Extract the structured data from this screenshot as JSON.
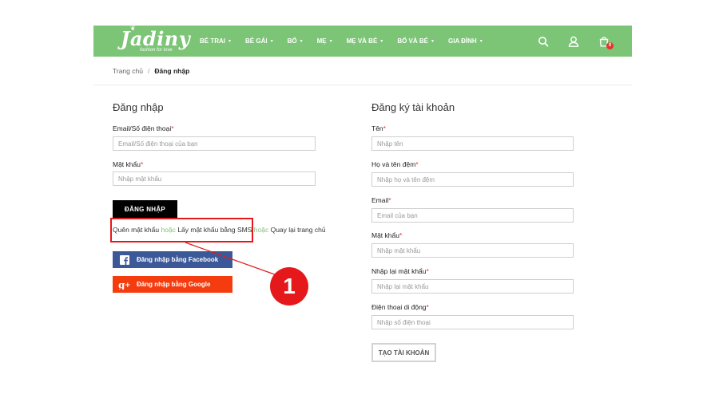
{
  "brand": {
    "logo_text": "Jadiny",
    "tagline": "fashion for love"
  },
  "nav": {
    "menu": [
      {
        "label": "BÉ TRAI"
      },
      {
        "label": "BÉ GÁI"
      },
      {
        "label": "BỐ"
      },
      {
        "label": "MẸ"
      },
      {
        "label": "MẸ VÀ BÉ"
      },
      {
        "label": "BỐ VÀ BÉ"
      },
      {
        "label": "GIA ĐÌNH"
      }
    ],
    "cart_count": "0",
    "colors": {
      "bar": "#7cc576",
      "badge": "#e4322c"
    }
  },
  "breadcrumb": {
    "home": "Trang chủ",
    "separator": "/",
    "current": "Đăng nhập"
  },
  "login": {
    "title": "Đăng nhập",
    "email_label": "Email/Số điện thoại",
    "email_placeholder": "Email/Số điện thoại của bạn",
    "password_label": "Mật khẩu",
    "password_placeholder": "Nhập mật khẩu",
    "submit_label": "ĐĂNG NHẬP",
    "forgot_link": "Quên mật khẩu",
    "or1": "hoặc",
    "sms_link": "Lấy mật khẩu bằng SMS",
    "or2": "hoặc",
    "home_link": "Quay lại trang chủ",
    "facebook_label": "Đăng nhập bằng Facebook",
    "google_label": "Đăng nhập bằng Google",
    "colors": {
      "facebook": "#3b5998",
      "google": "#f53c0f"
    }
  },
  "register": {
    "title": "Đăng ký tài khoản",
    "fields": [
      {
        "label": "Tên",
        "placeholder": "Nhập tên"
      },
      {
        "label": "Họ và tên đệm",
        "placeholder": "Nhập họ và tên đệm"
      },
      {
        "label": "Email",
        "placeholder": "Email của bạn"
      },
      {
        "label": "Mật khẩu",
        "placeholder": "Nhập mật khẩu"
      },
      {
        "label": "Nhập lại mật khẩu",
        "placeholder": "Nhập lại mật khẩu"
      },
      {
        "label": "Điện thoại di động",
        "placeholder": "Nhập số điện thoại"
      }
    ],
    "required_mark": "*",
    "submit_label": "TẠO TÀI KHOẢN"
  },
  "annotation": {
    "callout_number": "1",
    "color": "#e5191b"
  }
}
